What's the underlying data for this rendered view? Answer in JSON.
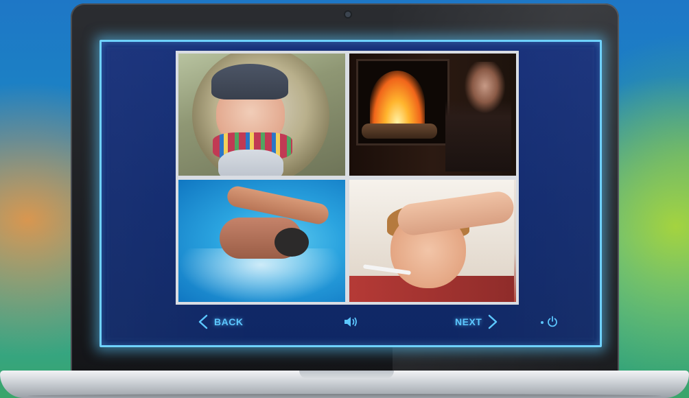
{
  "navigation": {
    "back_label": "BACK",
    "next_label": "NEXT"
  },
  "icons": {
    "back": "chevron-left-icon",
    "next": "chevron-right-icon",
    "sound": "speaker-icon",
    "power": "power-icon"
  },
  "colors": {
    "accent": "#5cc7ff",
    "screen_bg": "#132c72",
    "screen_border": "#6fd2ff"
  },
  "photos": [
    {
      "subject": "child-in-winter-hood"
    },
    {
      "subject": "person-by-fireplace"
    },
    {
      "subject": "swimmer"
    },
    {
      "subject": "sick-child-with-thermometer"
    }
  ]
}
